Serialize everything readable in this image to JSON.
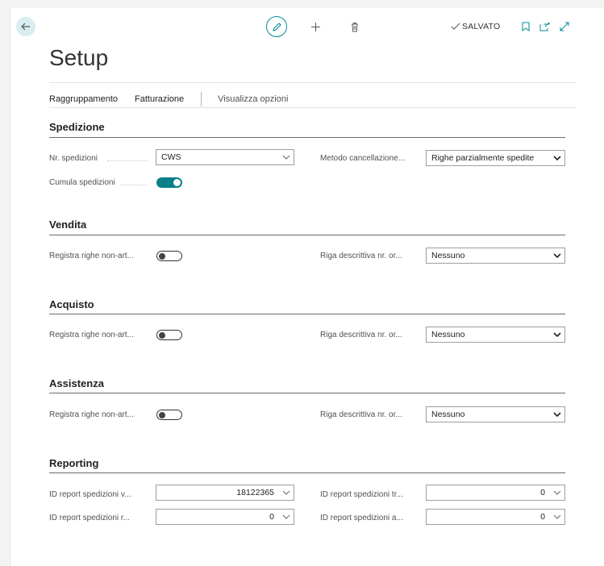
{
  "header": {
    "status": "SALVATO",
    "title": "Setup"
  },
  "actions": {
    "grouping": "Raggruppamento",
    "invoicing": "Fatturazione",
    "view_options": "Visualizza opzioni"
  },
  "spedizione": {
    "title": "Spedizione",
    "nr_label": "Nr. spedizioni",
    "nr_value": "CWS",
    "cumula_label": "Cumula spedizioni",
    "cumula_on": true,
    "metodo_label": "Metodo cancellazione...",
    "metodo_value": "Righe parzialmente spedite"
  },
  "vendita": {
    "title": "Vendita",
    "registra_label": "Registra righe non-art...",
    "registra_on": false,
    "riga_label": "Riga descrittiva nr. or...",
    "riga_value": "Nessuno"
  },
  "acquisto": {
    "title": "Acquisto",
    "registra_label": "Registra righe non-art...",
    "registra_on": false,
    "riga_label": "Riga descrittiva nr. or...",
    "riga_value": "Nessuno"
  },
  "assistenza": {
    "title": "Assistenza",
    "registra_label": "Registra righe non-art...",
    "registra_on": false,
    "riga_label": "Riga descrittiva nr. or...",
    "riga_value": "Nessuno"
  },
  "reporting": {
    "title": "Reporting",
    "r1_label": "ID report spedizioni v...",
    "r1_value": "18122365",
    "r2_label": "ID report spedizioni tr...",
    "r2_value": "0",
    "r3_label": "ID report spedizioni r...",
    "r3_value": "0",
    "r4_label": "ID report spedizioni a...",
    "r4_value": "0"
  },
  "colors": {
    "accent": "#0a7f8a",
    "back_bg": "#d9edef"
  },
  "icons": [
    "back-arrow-icon",
    "edit-pencil-icon",
    "plus-icon",
    "trash-icon",
    "checkmark-icon",
    "bookmark-icon",
    "open-new-icon",
    "expand-icon",
    "chevron-down-icon"
  ]
}
